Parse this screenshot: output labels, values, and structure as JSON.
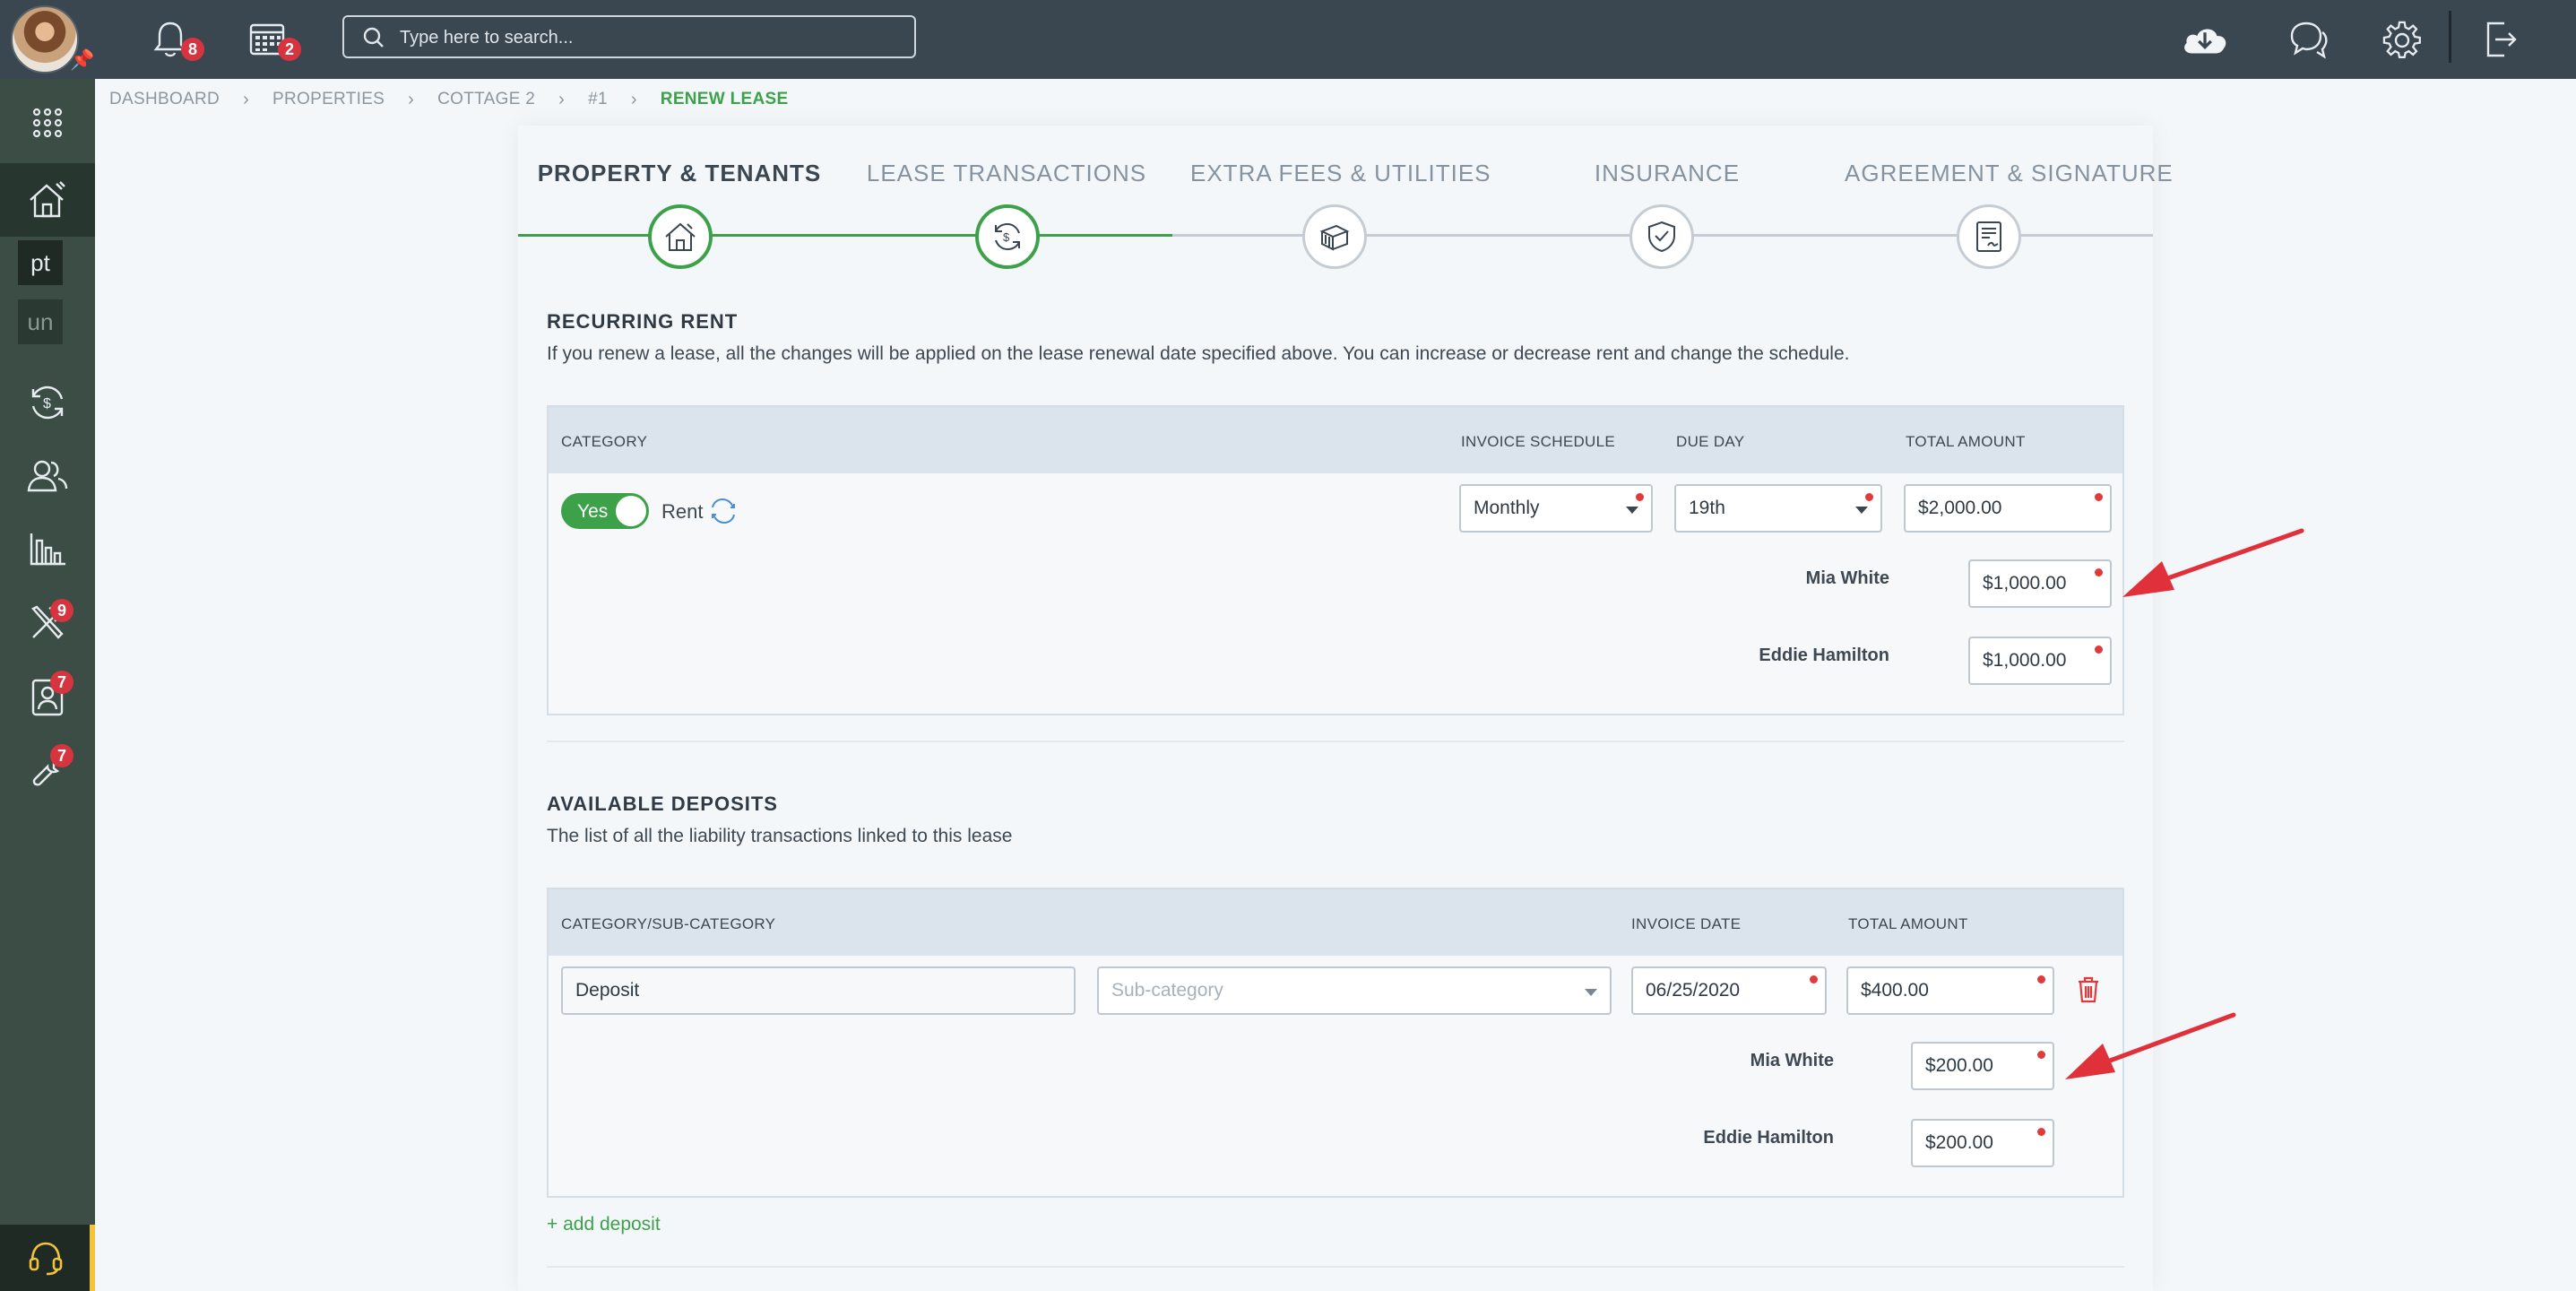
{
  "topbar": {
    "notifications_count": "8",
    "calendar_count": "2",
    "search_placeholder": "Type here to search..."
  },
  "sidebar": {
    "item_pt": "pt",
    "item_un": "un",
    "maintenance_count": "9",
    "tenants_count": "7",
    "tools_count": "7"
  },
  "breadcrumb": [
    "DASHBOARD",
    "PROPERTIES",
    "COTTAGE 2",
    "#1",
    "RENEW LEASE"
  ],
  "steps": [
    "PROPERTY & TENANTS",
    "LEASE TRANSACTIONS",
    "EXTRA FEES & UTILITIES",
    "INSURANCE",
    "AGREEMENT & SIGNATURE"
  ],
  "recurring": {
    "title": "RECURRING RENT",
    "description": "If you renew a lease, all the changes will be applied on the lease renewal date specified above. You can increase or decrease rent and change the schedule.",
    "headers": {
      "category": "CATEGORY",
      "invoice_schedule": "INVOICE SCHEDULE",
      "due_day": "DUE DAY",
      "total_amount": "TOTAL AMOUNT"
    },
    "toggle_label": "Yes",
    "category_label": "Rent",
    "schedule": "Monthly",
    "due_day": "19th",
    "total": "$2,000.00",
    "tenants": [
      {
        "name": "Mia White",
        "amount": "$1,000.00"
      },
      {
        "name": "Eddie Hamilton",
        "amount": "$1,000.00"
      }
    ]
  },
  "deposits": {
    "title": "AVAILABLE DEPOSITS",
    "description": "The list of all the liability transactions linked to this lease",
    "headers": {
      "category": "CATEGORY/SUB-CATEGORY",
      "invoice_date": "INVOICE DATE",
      "total_amount": "TOTAL AMOUNT"
    },
    "category": "Deposit",
    "subcategory_placeholder": "Sub-category",
    "invoice_date": "06/25/2020",
    "total": "$400.00",
    "tenants": [
      {
        "name": "Mia White",
        "amount": "$200.00"
      },
      {
        "name": "Eddie Hamilton",
        "amount": "$200.00"
      }
    ],
    "add_label": "+ add deposit"
  },
  "colors": {
    "accent": "#3da14a",
    "topbar": "#3a4650",
    "sidebar": "#3b4d45",
    "badge": "#d6353f",
    "annotation_arrow": "#e0303a"
  }
}
